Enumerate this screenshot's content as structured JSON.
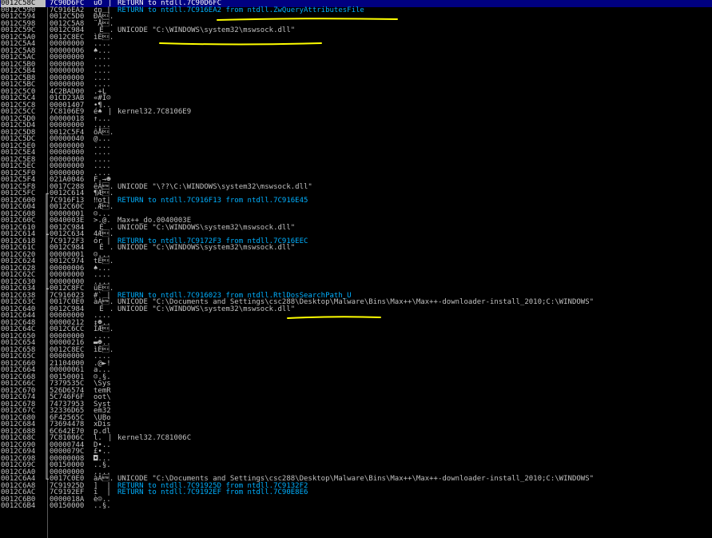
{
  "stack": {
    "rows": [
      {
        "addr": "0012C58C",
        "val": "7C90D6FC",
        "asc": "üÖ|",
        "cmt": "RETURN to ntdll.7C90D6FC",
        "type": "ret"
      },
      {
        "addr": "0012C590",
        "val": "7C916EA2",
        "asc": "¢n|",
        "cmt": "RETURN to ntdll.7C916EA2 from ntdll.ZwQueryAttributesFile",
        "type": "ret"
      },
      {
        "addr": "0012C594",
        "val": "0012C5D0",
        "asc": "ÐÅ\u0012.",
        "cmt": "",
        "type": ""
      },
      {
        "addr": "0012C598",
        "val": "0012C5A8",
        "asc": "¨Å\u0012.",
        "cmt": "",
        "type": ""
      },
      {
        "addr": "0012C59C",
        "val": "0012C984",
        "asc": "É\u0012.",
        "cmt": "UNICODE \"C:\\WINDOWS\\system32\\mswsock.dll\"",
        "type": ""
      },
      {
        "addr": "0012C5A0",
        "val": "0012C8EC",
        "asc": "ìÈ\u0012.",
        "cmt": "",
        "type": ""
      },
      {
        "addr": "0012C5A4",
        "val": "00000000",
        "asc": "....",
        "cmt": "",
        "type": ""
      },
      {
        "addr": "0012C5A8",
        "val": "00000006",
        "asc": "♠...",
        "cmt": "",
        "type": ""
      },
      {
        "addr": "0012C5AC",
        "val": "00000000",
        "asc": "....",
        "cmt": "",
        "type": ""
      },
      {
        "addr": "0012C5B0",
        "val": "00000000",
        "asc": "....",
        "cmt": "",
        "type": ""
      },
      {
        "addr": "0012C5B4",
        "val": "00000000",
        "asc": "....",
        "cmt": "",
        "type": ""
      },
      {
        "addr": "0012C5B8",
        "val": "00000000",
        "asc": "....",
        "cmt": "",
        "type": ""
      },
      {
        "addr": "0012C5BC",
        "val": "00000000",
        "asc": "....",
        "cmt": "",
        "type": ""
      },
      {
        "addr": "0012C5C0",
        "val": "4C2BAD00",
        "asc": ".­+L",
        "cmt": "",
        "type": ""
      },
      {
        "addr": "0012C5C4",
        "val": "01CD23AB",
        "asc": "«#Í☺",
        "cmt": "",
        "type": ""
      },
      {
        "addr": "0012C5C8",
        "val": "00001407",
        "asc": "•¶..",
        "cmt": "",
        "type": ""
      },
      {
        "addr": "0012C5CC",
        "val": "7C8106E9",
        "asc": "é♠|",
        "cmt": "kernel32.7C8106E9",
        "type": ""
      },
      {
        "addr": "0012C5D0",
        "val": "00000018",
        "asc": "↑...",
        "cmt": "",
        "type": ""
      },
      {
        "addr": "0012C5D4",
        "val": "00000000",
        "asc": "....",
        "cmt": "",
        "type": ""
      },
      {
        "addr": "0012C5D8",
        "val": "0012C5F4",
        "asc": "ôÅ\u0012.",
        "cmt": "",
        "type": ""
      },
      {
        "addr": "0012C5DC",
        "val": "00000040",
        "asc": "@...",
        "cmt": "",
        "type": ""
      },
      {
        "addr": "0012C5E0",
        "val": "00000000",
        "asc": "....",
        "cmt": "",
        "type": ""
      },
      {
        "addr": "0012C5E4",
        "val": "00000000",
        "asc": "....",
        "cmt": "",
        "type": ""
      },
      {
        "addr": "0012C5E8",
        "val": "00000000",
        "asc": "....",
        "cmt": "",
        "type": ""
      },
      {
        "addr": "0012C5EC",
        "val": "00000000",
        "asc": "....",
        "cmt": "",
        "type": ""
      },
      {
        "addr": "0012C5F0",
        "val": "00000000",
        "asc": "....",
        "cmt": "",
        "type": ""
      },
      {
        "addr": "0012C5F4",
        "val": "021A0046",
        "asc": "F.→☻",
        "cmt": "",
        "type": ""
      },
      {
        "addr": "0012C5F8",
        "val": "0017C288",
        "asc": "êÂ\u0017.",
        "cmt": "UNICODE \"\\??\\C:\\WINDOWS\\system32\\mswsock.dll\"",
        "type": ""
      },
      {
        "addr": "0012C5FC",
        "val": "0012C614",
        "asc": "¶Æ\u0012.",
        "cmt": "",
        "type": ""
      },
      {
        "addr": "0012C600",
        "val": "7C916F13",
        "asc": "‼ot|",
        "cmt": "RETURN to ntdll.7C916F13 from ntdll.7C916E45",
        "type": "ret"
      },
      {
        "addr": "0012C604",
        "val": "0012C60C",
        "asc": ".Æ\u0012.",
        "cmt": "",
        "type": ""
      },
      {
        "addr": "0012C608",
        "val": "00000001",
        "asc": "☺...",
        "cmt": "",
        "type": ""
      },
      {
        "addr": "0012C60C",
        "val": "0040003E",
        "asc": ">.@.",
        "cmt": "Max++_do.0040003E",
        "type": ""
      },
      {
        "addr": "0012C610",
        "val": "0012C984",
        "asc": "É\u0012.",
        "cmt": "UNICODE \"C:\\WINDOWS\\system32\\mswsock.dll\"",
        "type": ""
      },
      {
        "addr": "0012C614",
        "val": "0012C634",
        "asc": "4Æ\u0012.",
        "cmt": "",
        "type": ""
      },
      {
        "addr": "0012C618",
        "val": "7C9172F3",
        "asc": "ór|",
        "cmt": "RETURN to ntdll.7C9172F3 from ntdll.7C916EEC",
        "type": "ret"
      },
      {
        "addr": "0012C61C",
        "val": "0012C984",
        "asc": "É\u0012.",
        "cmt": "UNICODE \"C:\\WINDOWS\\system32\\mswsock.dll\"",
        "type": ""
      },
      {
        "addr": "0012C620",
        "val": "00000001",
        "asc": "☺...",
        "cmt": "",
        "type": ""
      },
      {
        "addr": "0012C624",
        "val": "0012C974",
        "asc": "tÉ\u0012.",
        "cmt": "",
        "type": ""
      },
      {
        "addr": "0012C628",
        "val": "00000006",
        "asc": "♠...",
        "cmt": "",
        "type": ""
      },
      {
        "addr": "0012C62C",
        "val": "00000000",
        "asc": "....",
        "cmt": "",
        "type": ""
      },
      {
        "addr": "0012C630",
        "val": "00000000",
        "asc": "....",
        "cmt": "",
        "type": ""
      },
      {
        "addr": "0012C634",
        "val": "0012C8FC",
        "asc": "üÈ\u0012.",
        "cmt": "",
        "type": ""
      },
      {
        "addr": "0012C638",
        "val": "7C916023",
        "asc": "#`|",
        "cmt": "RETURN to ntdll.7C916023 from ntdll.RtlDosSearchPath_U",
        "type": "ret"
      },
      {
        "addr": "0012C63C",
        "val": "0017C0E0",
        "asc": "àÀ\u0017.",
        "cmt": "UNICODE \"C:\\Documents and Settings\\csc288\\Desktop\\Malware\\Bins\\Max++\\Max++-downloader-install_2010;C:\\WINDOWS\"",
        "type": ""
      },
      {
        "addr": "0012C640",
        "val": "0012C984",
        "asc": "É\u0012.",
        "cmt": "UNICODE \"C:\\WINDOWS\\system32\\mswsock.dll\"",
        "type": ""
      },
      {
        "addr": "0012C644",
        "val": "00000000",
        "asc": "....",
        "cmt": "",
        "type": ""
      },
      {
        "addr": "0012C648",
        "val": "00000212",
        "asc": "↕☻..",
        "cmt": "",
        "type": ""
      },
      {
        "addr": "0012C64C",
        "val": "0012C6CC",
        "asc": "ÌÆ\u0012.",
        "cmt": "",
        "type": ""
      },
      {
        "addr": "0012C650",
        "val": "00000000",
        "asc": "....",
        "cmt": "",
        "type": ""
      },
      {
        "addr": "0012C654",
        "val": "00000216",
        "asc": "▬☻..",
        "cmt": "",
        "type": ""
      },
      {
        "addr": "0012C658",
        "val": "0012C8EC",
        "asc": "ìÈ\u0012.",
        "cmt": "",
        "type": ""
      },
      {
        "addr": "0012C65C",
        "val": "00000000",
        "asc": "....",
        "cmt": "",
        "type": ""
      },
      {
        "addr": "0012C660",
        "val": "21104000",
        "asc": ".@►!",
        "cmt": "",
        "type": ""
      },
      {
        "addr": "0012C664",
        "val": "00000061",
        "asc": "a...",
        "cmt": "",
        "type": ""
      },
      {
        "addr": "0012C668",
        "val": "00150001",
        "asc": "☺.§.",
        "cmt": "",
        "type": ""
      },
      {
        "addr": "0012C66C",
        "val": "7379535C",
        "asc": "\\Sys",
        "cmt": "",
        "type": ""
      },
      {
        "addr": "0012C670",
        "val": "526D6574",
        "asc": "temR",
        "cmt": "",
        "type": ""
      },
      {
        "addr": "0012C674",
        "val": "5C746F6F",
        "asc": "oot\\",
        "cmt": "",
        "type": ""
      },
      {
        "addr": "0012C678",
        "val": "74737953",
        "asc": "Syst",
        "cmt": "",
        "type": ""
      },
      {
        "addr": "0012C67C",
        "val": "32336D65",
        "asc": "em32",
        "cmt": "",
        "type": ""
      },
      {
        "addr": "0012C680",
        "val": "6F42565C",
        "asc": "\\UBo",
        "cmt": "",
        "type": ""
      },
      {
        "addr": "0012C684",
        "val": "73694478",
        "asc": "xDis",
        "cmt": "",
        "type": ""
      },
      {
        "addr": "0012C688",
        "val": "6C642E70",
        "asc": "p.dl",
        "cmt": "",
        "type": ""
      },
      {
        "addr": "0012C68C",
        "val": "7C81006C",
        "asc": "l.|",
        "cmt": "kernel32.7C81006C",
        "type": ""
      },
      {
        "addr": "0012C690",
        "val": "00000744",
        "asc": "D•..",
        "cmt": "",
        "type": ""
      },
      {
        "addr": "0012C694",
        "val": "0000079C",
        "asc": "£•..",
        "cmt": "",
        "type": ""
      },
      {
        "addr": "0012C698",
        "val": "00000008",
        "asc": "◘...",
        "cmt": "",
        "type": ""
      },
      {
        "addr": "0012C69C",
        "val": "00150000",
        "asc": "..§.",
        "cmt": "",
        "type": ""
      },
      {
        "addr": "0012C6A0",
        "val": "00000000",
        "asc": "....",
        "cmt": "",
        "type": ""
      },
      {
        "addr": "0012C6A4",
        "val": "0017C0E0",
        "asc": "àÀ\u0017.",
        "cmt": "UNICODE \"C:\\Documents and Settings\\csc288\\Desktop\\Malware\\Bins\\Max++\\Max++-downloader-install_2010;C:\\WINDOWS\"",
        "type": ""
      },
      {
        "addr": "0012C6A8",
        "val": "7C91925D",
        "asc": "]|",
        "cmt": "RETURN to ntdll.7C91925D from ntdll.7C9132F2",
        "type": "ret"
      },
      {
        "addr": "0012C6AC",
        "val": "7C9192EF",
        "asc": "ï|",
        "cmt": "RETURN to ntdll.7C9192EF from ntdll.7C90E8E6",
        "type": "ret"
      },
      {
        "addr": "0012C6B0",
        "val": "0000018A",
        "asc": "è☺..",
        "cmt": "",
        "type": ""
      },
      {
        "addr": "0012C6B4",
        "val": "00150000",
        "asc": "..§.",
        "cmt": "",
        "type": ""
      }
    ],
    "colors": {
      "background": "#000000",
      "text": "#c0c0c0",
      "return_comment": "#00b0ff",
      "selected_row": "#000080",
      "annotation": "#ffff00"
    }
  }
}
